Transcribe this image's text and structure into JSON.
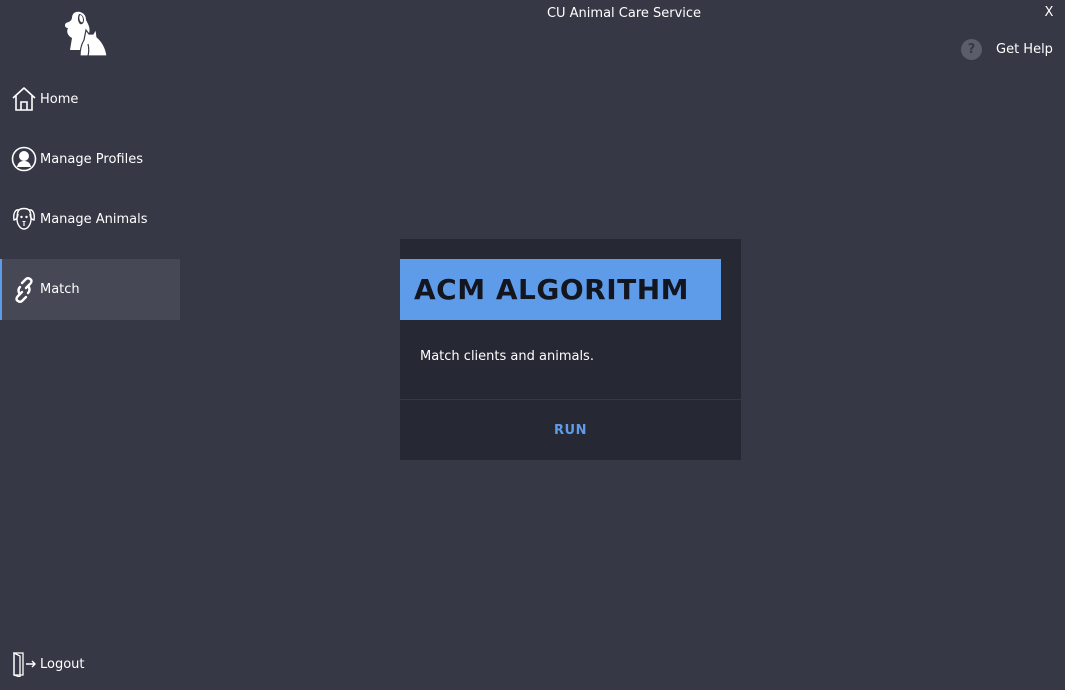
{
  "window": {
    "title": "CU Animal Care Service",
    "close_label": "X"
  },
  "header": {
    "help_icon_glyph": "?",
    "help_label": "Get Help"
  },
  "sidebar": {
    "items": [
      {
        "label": "Home",
        "icon": "home-icon"
      },
      {
        "label": "Manage Profiles",
        "icon": "profile-icon"
      },
      {
        "label": "Manage Animals",
        "icon": "dog-face-icon"
      },
      {
        "label": "Match",
        "icon": "link-icon",
        "active": true
      }
    ],
    "logout_label": "Logout"
  },
  "card": {
    "title": "ACM ALGORITHM",
    "description": "Match clients and animals.",
    "action_label": "RUN"
  },
  "colors": {
    "background": "#363846",
    "card": "#262833",
    "accent": "#5e9ce9",
    "active_item": "#464855"
  }
}
